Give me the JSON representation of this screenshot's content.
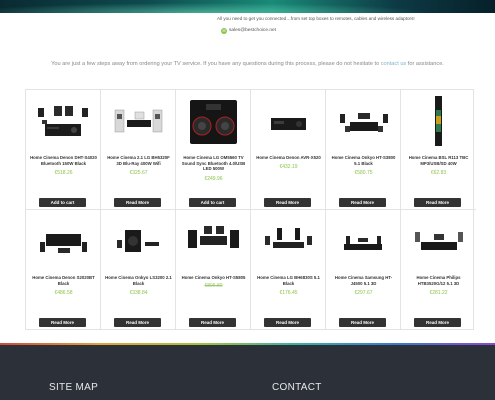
{
  "header": {
    "tagline": "All you need to get you connected…from set top boxes to remotes, cables and wireless adaptors!",
    "email": "sales@bestchoice.net",
    "email_icon": "envelope-icon"
  },
  "intro": {
    "text_before": "You are just a few steps away from ordering your TV service. If you have any questions during this process, please do not hesitate to ",
    "link": "contact us",
    "text_after": " for assistance."
  },
  "colors": {
    "price": "#8bc34a",
    "button": "#333333",
    "footer": "#2b3039"
  },
  "products": [
    {
      "name": "Home Cinema Denon DHT-S4020 Bluetooth 150W Black",
      "price": "€518.26",
      "button": "Add to cart",
      "strike": false
    },
    {
      "name": "Home Cinema 2.1 LG BH5320F 3D Blu-Ray 400W Wifi",
      "price": "€325.67",
      "button": "Read More",
      "strike": false
    },
    {
      "name": "Home Cinema LG OM5560 TV Sound Sync Bluetooth 4.0/USB LED 500W",
      "price": "€249.96",
      "button": "Add to cart",
      "strike": false
    },
    {
      "name": "Home Cinema Denon AVR-X520",
      "price": "€432.19",
      "button": "Read More",
      "strike": false
    },
    {
      "name": "Home Cinema Onkyo HT-S3800 5.1 Black",
      "price": "€580.75",
      "button": "Read More",
      "strike": false
    },
    {
      "name": "Home Cinema BSL R113 TBC MP3/USB/SD 40W",
      "price": "€62.83",
      "button": "Read More",
      "strike": false
    },
    {
      "name": "Home Cinema Denon S2020BT Black",
      "price": "€486.58",
      "button": "Read More",
      "strike": false
    },
    {
      "name": "Home Cinema Onkyo LS3200 2.1 Black",
      "price": "€338.84",
      "button": "Read More",
      "strike": false
    },
    {
      "name": "Home Cinema Onkyo HT-S5805",
      "price": "€896.80",
      "button": "Read More",
      "strike": true
    },
    {
      "name": "Home Cinema LG BH6830S 5.1 Black",
      "price": "€176.45",
      "button": "Read More",
      "strike": false
    },
    {
      "name": "Home Cinema Samsung HT-J4500 5.1 3D",
      "price": "€297.67",
      "button": "Read More",
      "strike": false
    },
    {
      "name": "Home Cinema Philips HTB3520G/12 5.1 3D",
      "price": "€281.22",
      "button": "Read More",
      "strike": false
    }
  ],
  "footer": {
    "sitemap": "SITE MAP",
    "contact": "CONTACT"
  }
}
